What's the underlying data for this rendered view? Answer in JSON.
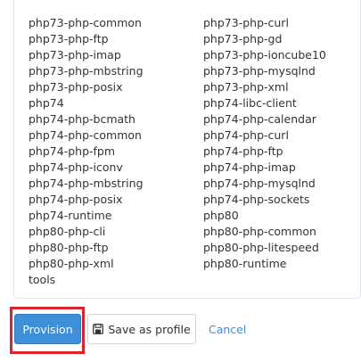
{
  "packages": {
    "left": [
      "php73-php-common",
      "php73-php-ftp",
      "php73-php-imap",
      "php73-php-mbstring",
      "php73-php-posix",
      "php74",
      "php74-php-bcmath",
      "php74-php-common",
      "php74-php-fpm",
      "php74-php-iconv",
      "php74-php-mbstring",
      "php74-php-posix",
      "php74-runtime",
      "php80-php-cli",
      "php80-php-ftp",
      "php80-php-xml",
      "tools"
    ],
    "right": [
      "php73-php-curl",
      "php73-php-gd",
      "php73-php-ioncube10",
      "php73-php-mysqlnd",
      "php73-php-xml",
      "php74-libc-client",
      "php74-php-calendar",
      "php74-php-curl",
      "php74-php-ftp",
      "php74-php-imap",
      "php74-php-mysqlnd",
      "php74-php-sockets",
      "php80",
      "php80-php-common",
      "php80-php-litespeed",
      "php80-runtime"
    ]
  },
  "actions": {
    "provision_label": "Provision",
    "save_profile_label": "Save as profile",
    "cancel_label": "Cancel",
    "save_icon": "floppy-disk-icon"
  },
  "colors": {
    "primary": "#3d8fd8",
    "highlight": "#d9232d",
    "text": "#333333"
  }
}
